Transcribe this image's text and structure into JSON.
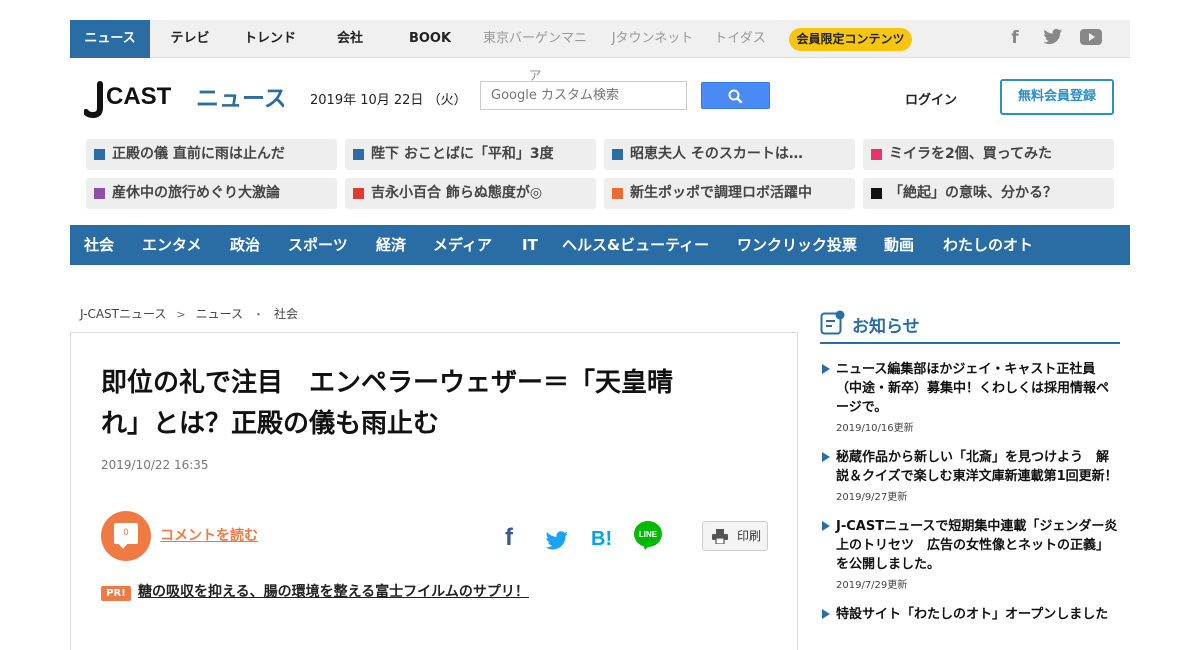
{
  "topnav": {
    "items": [
      "ニュース",
      "テレビ",
      "トレンド",
      "会社",
      "BOOK"
    ],
    "external": [
      "東京バーゲンマニア",
      "Jタウンネット",
      "トイダス"
    ],
    "member_label": "会員限定コンテンツ",
    "social_icons": [
      "facebook-icon",
      "twitter-icon",
      "youtube-icon"
    ]
  },
  "header": {
    "logo_j": "J",
    "logo_cast": "CAST",
    "logo_news": "ニュース",
    "date": "2019年 10月 22日 （火）",
    "search_placeholder": "Google カスタム検索",
    "login_label": "ログイン",
    "register_label": "無料会員登録"
  },
  "trending": [
    {
      "label": "正殿の儀 直前に雨は止んだ",
      "color": "#2a6ca4"
    },
    {
      "label": "陛下 おことばに「平和」3度",
      "color": "#2a6ca4"
    },
    {
      "label": "昭恵夫人 そのスカートは…",
      "color": "#2a6ca4"
    },
    {
      "label": "ミイラを2個、買ってみた",
      "color": "#e8336e"
    },
    {
      "label": "産休中の旅行めぐり大激論",
      "color": "#8e4fa8"
    },
    {
      "label": "吉永小百合 飾らぬ態度が◎",
      "color": "#e03b2e"
    },
    {
      "label": "新生ポッポで調理ロボ活躍中",
      "color": "#f06a30"
    },
    {
      "label": "「絶起」の意味、分かる？",
      "color": "#111111"
    }
  ],
  "categories": [
    "社会",
    "エンタメ",
    "政治",
    "スポーツ",
    "経済",
    "メディア",
    "IT",
    "ヘルス&ビューティー",
    "ワンクリック投票",
    "動画",
    "わたしのオト"
  ],
  "category_pr": "PR",
  "breadcrumb": [
    "J-CASTニュース",
    "ニュース",
    "社会"
  ],
  "breadcrumb_seps": [
    ">",
    "・"
  ],
  "article": {
    "title_line1": "即位の礼で注目　エンペラーウェザー＝「天皇晴",
    "title_line2": "れ」とは？正殿の儀も雨止む",
    "date": "2019/10/22 16:35",
    "comment_count": "0",
    "comment_label": "コメントを読む",
    "share_icons": [
      "facebook-icon",
      "twitter-icon",
      "hatena-bookmark-icon",
      "line-icon"
    ],
    "hatena_label": "B!",
    "line_label": "LINE",
    "print_label": "印刷",
    "pr_badge": "PR!",
    "pr_text": "糖の吸収を抑える、腸の環境を整える富士フイルムのサプリ！"
  },
  "sidebar": {
    "notice_title": "お知らせ",
    "items": [
      {
        "text": "ニュース編集部ほかジェイ・キャスト正社員（中途・新卒）募集中！くわしくは採用情報ページで。",
        "date": "2019/10/16更新"
      },
      {
        "text": "秘蔵作品から新しい「北斎」を見つけよう　解説＆クイズで楽しむ東洋文庫新連載第1回更新！",
        "date": "2019/9/27更新"
      },
      {
        "text": "J-CASTニュースで短期集中連載「ジェンダー炎上のトリセツ　広告の女性像とネットの正義」を公開しました。",
        "date": "2019/7/29更新"
      },
      {
        "text": "特設サイト「わたしのオト」オープンしました",
        "date": ""
      }
    ]
  },
  "colors": {
    "brand": "#2a6ca4",
    "accent": "#f07a43",
    "member": "#f6c60f"
  }
}
